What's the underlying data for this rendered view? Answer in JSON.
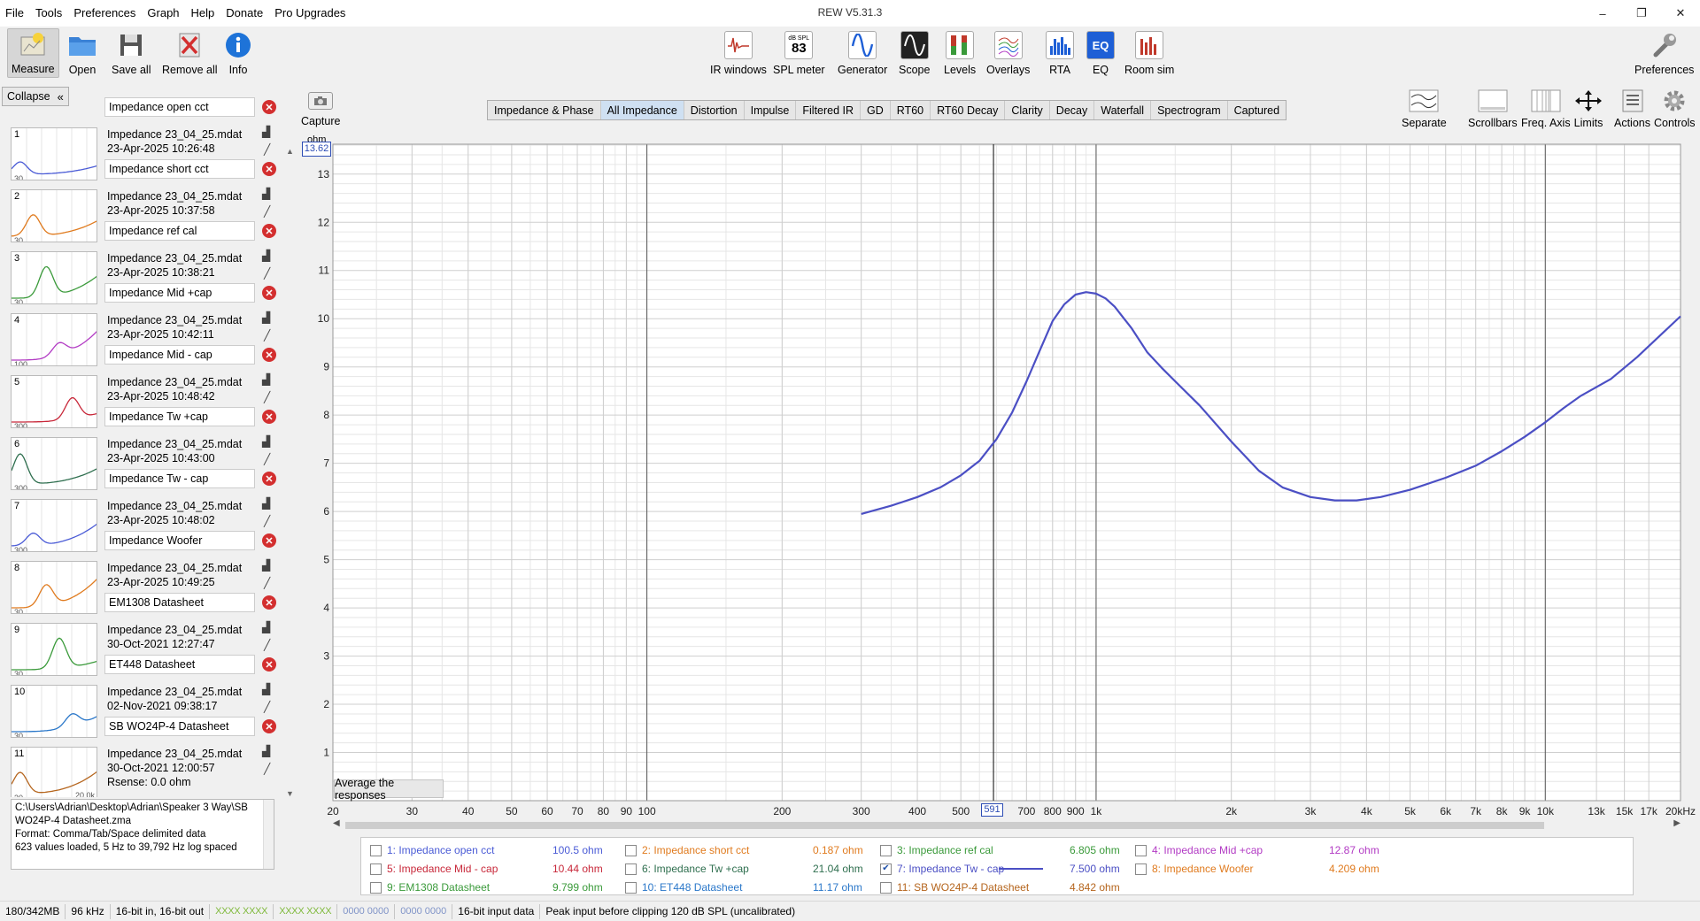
{
  "window": {
    "title": "REW V5.31.3",
    "menu": [
      "File",
      "Tools",
      "Preferences",
      "Graph",
      "Help",
      "Donate",
      "Pro Upgrades"
    ],
    "minimize": "–",
    "restore": "❐",
    "close": "✕"
  },
  "toolbar": {
    "measure": "Measure",
    "open": "Open",
    "save_all": "Save all",
    "remove_all": "Remove all",
    "info": "Info",
    "ir_windows": "IR windows",
    "spl_meter": "SPL meter",
    "spl_top": "dB SPL",
    "spl_value": "83",
    "generator": "Generator",
    "scope": "Scope",
    "levels": "Levels",
    "overlays": "Overlays",
    "rta": "RTA",
    "eq": "EQ",
    "eq_glyph": "EQ",
    "room_sim": "Room sim",
    "preferences": "Preferences"
  },
  "left_panel": {
    "collapse": "Collapse",
    "collapse_glyph": "«",
    "measurements": [
      {
        "num": "1",
        "name": "Impedance open cct",
        "file": "Impedance 23_04_25.mdat",
        "date": "23-Apr-2025 10:26:48",
        "color": "#4a5bd6",
        "thumb_label": "30"
      },
      {
        "num": "2",
        "name": "Impedance short cct",
        "file": "Impedance 23_04_25.mdat",
        "date": "23-Apr-2025 10:37:58",
        "color": "#e07b1f",
        "thumb_label": "30"
      },
      {
        "num": "3",
        "name": "Impedance ref cal",
        "file": "Impedance 23_04_25.mdat",
        "date": "23-Apr-2025 10:38:21",
        "color": "#3a9a3a",
        "thumb_label": "30"
      },
      {
        "num": "4",
        "name": "Impedance Mid +cap",
        "file": "Impedance 23_04_25.mdat",
        "date": "23-Apr-2025 10:42:11",
        "color": "#b23bc4",
        "thumb_label": "100"
      },
      {
        "num": "5",
        "name": "Impedance Mid - cap",
        "file": "Impedance 23_04_25.mdat",
        "date": "23-Apr-2025 10:48:42",
        "color": "#c8283a",
        "thumb_label": "300"
      },
      {
        "num": "6",
        "name": "Impedance Tw +cap",
        "file": "Impedance 23_04_25.mdat",
        "date": "23-Apr-2025 10:43:00",
        "color": "#2f6f4f",
        "thumb_label": "300"
      },
      {
        "num": "7",
        "name": "Impedance Tw - cap",
        "file": "Impedance 23_04_25.mdat",
        "date": "23-Apr-2025 10:48:02",
        "color": "#4a5bd6",
        "thumb_label": "300"
      },
      {
        "num": "8",
        "name": "Impedance Woofer",
        "file": "Impedance 23_04_25.mdat",
        "date": "23-Apr-2025 10:49:25",
        "color": "#e07b1f",
        "thumb_label": "30"
      },
      {
        "num": "9",
        "name": "EM1308 Datasheet",
        "file": "Impedance 23_04_25.mdat",
        "date": "30-Oct-2021 12:27:47",
        "color": "#3a9a3a",
        "thumb_label": "30"
      },
      {
        "num": "10",
        "name": "ET448 Datasheet",
        "file": "Impedance 23_04_25.mdat",
        "date": "02-Nov-2021 09:38:17",
        "color": "#2a77c9",
        "thumb_label": "30"
      },
      {
        "num": "11",
        "name": "SB WO24P-4 Datasheet",
        "file": "Impedance 23_04_25.mdat",
        "date": "30-Oct-2021 12:00:57",
        "extra": "Rsense: 0.0 ohm",
        "color": "#b5651d",
        "thumb_label": "30",
        "thumb_label_right": "20.0k"
      }
    ],
    "info": [
      "C:\\Users\\Adrian\\Desktop\\Adrian\\Speaker 3 Way\\SB WO24P-4 Datasheet.zma",
      "Format: Comma/Tab/Space delimited data",
      "623 values loaded, 5 Hz to 39,792 Hz log spaced"
    ]
  },
  "capture": {
    "label": "Capture"
  },
  "tabs": [
    "Impedance & Phase",
    "All Impedance",
    "Distortion",
    "Impulse",
    "Filtered IR",
    "GD",
    "RT60",
    "RT60 Decay",
    "Clarity",
    "Decay",
    "Waterfall",
    "Spectrogram",
    "Captured"
  ],
  "active_tab": "All Impedance",
  "right_tools": {
    "separate": "Separate",
    "scrollbars": "Scrollbars",
    "freq_axis": "Freq. Axis",
    "limits": "Limits",
    "actions": "Actions",
    "controls": "Controls"
  },
  "graph": {
    "unit": "ohm",
    "top_value": "13.62",
    "cursor_freq": "591",
    "average_button": "Average the responses",
    "colors": {
      "trace": "#4b4fc4",
      "grid_major": "#cfcfcf",
      "grid_minor": "#e6e6e6",
      "cursor": "#303030"
    }
  },
  "chart_data": {
    "type": "line",
    "xscale": "log",
    "xlim": [
      20,
      20000
    ],
    "ylim": [
      0,
      13.62
    ],
    "y_ticks": [
      1,
      2,
      3,
      4,
      5,
      6,
      7,
      8,
      9,
      10,
      11,
      12,
      13
    ],
    "x_ticks": [
      {
        "v": 20,
        "l": "20"
      },
      {
        "v": 30,
        "l": "30"
      },
      {
        "v": 40,
        "l": "40"
      },
      {
        "v": 50,
        "l": "50"
      },
      {
        "v": 60,
        "l": "60"
      },
      {
        "v": 70,
        "l": "70"
      },
      {
        "v": 80,
        "l": "80"
      },
      {
        "v": 90,
        "l": "90"
      },
      {
        "v": 100,
        "l": "100"
      },
      {
        "v": 200,
        "l": "200"
      },
      {
        "v": 300,
        "l": "300"
      },
      {
        "v": 400,
        "l": "400"
      },
      {
        "v": 500,
        "l": "500"
      },
      {
        "v": 700,
        "l": "700"
      },
      {
        "v": 800,
        "l": "800"
      },
      {
        "v": 900,
        "l": "900"
      },
      {
        "v": 1000,
        "l": "1k"
      },
      {
        "v": 2000,
        "l": "2k"
      },
      {
        "v": 3000,
        "l": "3k"
      },
      {
        "v": 4000,
        "l": "4k"
      },
      {
        "v": 5000,
        "l": "5k"
      },
      {
        "v": 6000,
        "l": "6k"
      },
      {
        "v": 7000,
        "l": "7k"
      },
      {
        "v": 8000,
        "l": "8k"
      },
      {
        "v": 9000,
        "l": "9k"
      },
      {
        "v": 10000,
        "l": "10k"
      },
      {
        "v": 13000,
        "l": "13k"
      },
      {
        "v": 15000,
        "l": "15k"
      },
      {
        "v": 17000,
        "l": "17k"
      },
      {
        "v": 20000,
        "l": "20kHz"
      }
    ],
    "cursor_x": 591,
    "series": [
      {
        "name": "7: Impedance Tw - cap",
        "color": "#4b4fc4",
        "x": [
          300,
          350,
          400,
          450,
          500,
          550,
          600,
          650,
          700,
          750,
          800,
          850,
          900,
          950,
          1000,
          1050,
          1100,
          1200,
          1300,
          1400,
          1500,
          1700,
          2000,
          2300,
          2600,
          3000,
          3400,
          3800,
          4300,
          5000,
          6000,
          7000,
          8000,
          9000,
          10000,
          11000,
          12000,
          14000,
          16000,
          18000,
          20000
        ],
        "y": [
          5.95,
          6.12,
          6.3,
          6.5,
          6.75,
          7.05,
          7.5,
          8.05,
          8.7,
          9.35,
          9.95,
          10.3,
          10.5,
          10.55,
          10.52,
          10.42,
          10.25,
          9.8,
          9.3,
          8.98,
          8.7,
          8.2,
          7.45,
          6.85,
          6.5,
          6.3,
          6.23,
          6.23,
          6.3,
          6.45,
          6.7,
          6.95,
          7.25,
          7.55,
          7.85,
          8.15,
          8.4,
          8.75,
          9.2,
          9.65,
          10.05
        ]
      }
    ]
  },
  "legend": [
    {
      "label": "1: Impedance open cct",
      "value": "100.5 ohm",
      "color": "#4a5bd6",
      "checked": false
    },
    {
      "label": "2: Impedance short cct",
      "value": "0.187 ohm",
      "color": "#e07b1f",
      "checked": false
    },
    {
      "label": "3: Impedance ref cal",
      "value": "6.805 ohm",
      "color": "#3a9a3a",
      "checked": false
    },
    {
      "label": "4: Impedance Mid +cap",
      "value": "12.87 ohm",
      "color": "#b23bc4",
      "checked": false
    },
    {
      "label": "5: Impedance Mid - cap",
      "value": "10.44 ohm",
      "color": "#c8283a",
      "checked": false
    },
    {
      "label": "6: Impedance Tw +cap",
      "value": "21.04 ohm",
      "color": "#2f6f4f",
      "checked": false
    },
    {
      "label": "7: Impedance Tw - cap",
      "value": "7.500 ohm",
      "color": "#4b4fc4",
      "checked": true
    },
    {
      "label": "8: Impedance Woofer",
      "value": "4.209 ohm",
      "color": "#e07b1f",
      "checked": false
    },
    {
      "label": "9: EM1308 Datasheet",
      "value": "9.799 ohm",
      "color": "#3a9a3a",
      "checked": false
    },
    {
      "label": "10: ET448 Datasheet",
      "value": "11.17 ohm",
      "color": "#2a77c9",
      "checked": false
    },
    {
      "label": "11: SB WO24P-4 Datasheet",
      "value": "4.842 ohm",
      "color": "#b5651d",
      "checked": false
    }
  ],
  "status": {
    "memory": "180/342MB",
    "rate": "96 kHz",
    "bits": "16-bit in, 16-bit out",
    "meter_a": "XXXX XXXX",
    "meter_b": "XXXX XXXX",
    "meter_c": "0000 0000",
    "meter_d": "0000 0000",
    "input_data": "16-bit input data",
    "peak": "Peak input before clipping 120 dB SPL (uncalibrated)"
  }
}
